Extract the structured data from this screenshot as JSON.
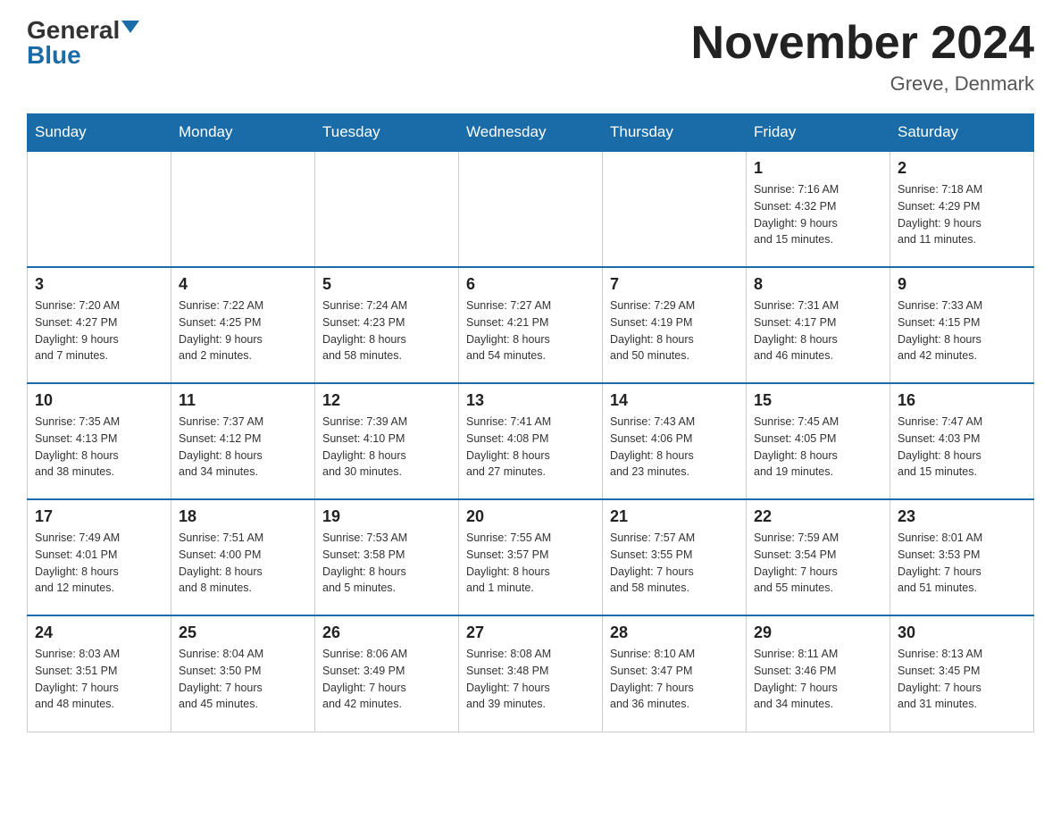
{
  "header": {
    "logo_general": "General",
    "logo_blue": "Blue",
    "title": "November 2024",
    "subtitle": "Greve, Denmark"
  },
  "days_of_week": [
    "Sunday",
    "Monday",
    "Tuesday",
    "Wednesday",
    "Thursday",
    "Friday",
    "Saturday"
  ],
  "weeks": [
    [
      {
        "day": "",
        "info": ""
      },
      {
        "day": "",
        "info": ""
      },
      {
        "day": "",
        "info": ""
      },
      {
        "day": "",
        "info": ""
      },
      {
        "day": "",
        "info": ""
      },
      {
        "day": "1",
        "info": "Sunrise: 7:16 AM\nSunset: 4:32 PM\nDaylight: 9 hours\nand 15 minutes."
      },
      {
        "day": "2",
        "info": "Sunrise: 7:18 AM\nSunset: 4:29 PM\nDaylight: 9 hours\nand 11 minutes."
      }
    ],
    [
      {
        "day": "3",
        "info": "Sunrise: 7:20 AM\nSunset: 4:27 PM\nDaylight: 9 hours\nand 7 minutes."
      },
      {
        "day": "4",
        "info": "Sunrise: 7:22 AM\nSunset: 4:25 PM\nDaylight: 9 hours\nand 2 minutes."
      },
      {
        "day": "5",
        "info": "Sunrise: 7:24 AM\nSunset: 4:23 PM\nDaylight: 8 hours\nand 58 minutes."
      },
      {
        "day": "6",
        "info": "Sunrise: 7:27 AM\nSunset: 4:21 PM\nDaylight: 8 hours\nand 54 minutes."
      },
      {
        "day": "7",
        "info": "Sunrise: 7:29 AM\nSunset: 4:19 PM\nDaylight: 8 hours\nand 50 minutes."
      },
      {
        "day": "8",
        "info": "Sunrise: 7:31 AM\nSunset: 4:17 PM\nDaylight: 8 hours\nand 46 minutes."
      },
      {
        "day": "9",
        "info": "Sunrise: 7:33 AM\nSunset: 4:15 PM\nDaylight: 8 hours\nand 42 minutes."
      }
    ],
    [
      {
        "day": "10",
        "info": "Sunrise: 7:35 AM\nSunset: 4:13 PM\nDaylight: 8 hours\nand 38 minutes."
      },
      {
        "day": "11",
        "info": "Sunrise: 7:37 AM\nSunset: 4:12 PM\nDaylight: 8 hours\nand 34 minutes."
      },
      {
        "day": "12",
        "info": "Sunrise: 7:39 AM\nSunset: 4:10 PM\nDaylight: 8 hours\nand 30 minutes."
      },
      {
        "day": "13",
        "info": "Sunrise: 7:41 AM\nSunset: 4:08 PM\nDaylight: 8 hours\nand 27 minutes."
      },
      {
        "day": "14",
        "info": "Sunrise: 7:43 AM\nSunset: 4:06 PM\nDaylight: 8 hours\nand 23 minutes."
      },
      {
        "day": "15",
        "info": "Sunrise: 7:45 AM\nSunset: 4:05 PM\nDaylight: 8 hours\nand 19 minutes."
      },
      {
        "day": "16",
        "info": "Sunrise: 7:47 AM\nSunset: 4:03 PM\nDaylight: 8 hours\nand 15 minutes."
      }
    ],
    [
      {
        "day": "17",
        "info": "Sunrise: 7:49 AM\nSunset: 4:01 PM\nDaylight: 8 hours\nand 12 minutes."
      },
      {
        "day": "18",
        "info": "Sunrise: 7:51 AM\nSunset: 4:00 PM\nDaylight: 8 hours\nand 8 minutes."
      },
      {
        "day": "19",
        "info": "Sunrise: 7:53 AM\nSunset: 3:58 PM\nDaylight: 8 hours\nand 5 minutes."
      },
      {
        "day": "20",
        "info": "Sunrise: 7:55 AM\nSunset: 3:57 PM\nDaylight: 8 hours\nand 1 minute."
      },
      {
        "day": "21",
        "info": "Sunrise: 7:57 AM\nSunset: 3:55 PM\nDaylight: 7 hours\nand 58 minutes."
      },
      {
        "day": "22",
        "info": "Sunrise: 7:59 AM\nSunset: 3:54 PM\nDaylight: 7 hours\nand 55 minutes."
      },
      {
        "day": "23",
        "info": "Sunrise: 8:01 AM\nSunset: 3:53 PM\nDaylight: 7 hours\nand 51 minutes."
      }
    ],
    [
      {
        "day": "24",
        "info": "Sunrise: 8:03 AM\nSunset: 3:51 PM\nDaylight: 7 hours\nand 48 minutes."
      },
      {
        "day": "25",
        "info": "Sunrise: 8:04 AM\nSunset: 3:50 PM\nDaylight: 7 hours\nand 45 minutes."
      },
      {
        "day": "26",
        "info": "Sunrise: 8:06 AM\nSunset: 3:49 PM\nDaylight: 7 hours\nand 42 minutes."
      },
      {
        "day": "27",
        "info": "Sunrise: 8:08 AM\nSunset: 3:48 PM\nDaylight: 7 hours\nand 39 minutes."
      },
      {
        "day": "28",
        "info": "Sunrise: 8:10 AM\nSunset: 3:47 PM\nDaylight: 7 hours\nand 36 minutes."
      },
      {
        "day": "29",
        "info": "Sunrise: 8:11 AM\nSunset: 3:46 PM\nDaylight: 7 hours\nand 34 minutes."
      },
      {
        "day": "30",
        "info": "Sunrise: 8:13 AM\nSunset: 3:45 PM\nDaylight: 7 hours\nand 31 minutes."
      }
    ]
  ]
}
